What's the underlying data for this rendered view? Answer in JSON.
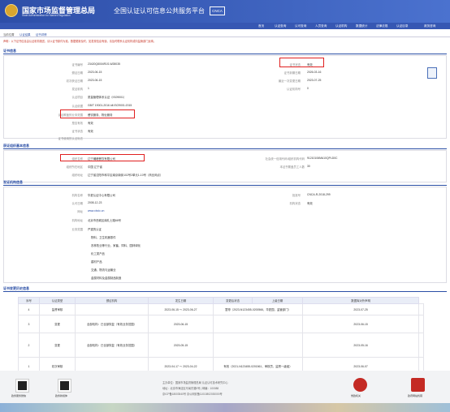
{
  "header": {
    "title": "国家市场监督管理总局",
    "title_en": "State Administration  for  Market Regulation",
    "subtitle": "全国认证认可信息公共服务平台",
    "logo_text": "CNCA"
  },
  "nav": [
    "首页",
    "认证查询",
    "认可查询",
    "人员查询",
    "认证机构",
    "数据统计",
    "法律法规",
    "认证目录",
    "政务咨询"
  ],
  "tabs": [
    "当前位置",
    "认证结果",
    "证书详情"
  ],
  "notice": "声明：以下证书信息由认证机构报送，请以证书原件为准。数据更新及时，如发现信息有误，请及时联系认证机构或向监管部门反映。",
  "sec1": {
    "title": "证书信息",
    "left": [
      [
        "证书编号",
        "23420Q8004R1S-W28035"
      ],
      [
        "颁证日期",
        "2023-06-15"
      ],
      [
        "初次获证日期",
        "2023-06-15"
      ],
      [
        "发证机构",
        "1"
      ],
      [
        "认证项目",
        "质量管理体系认证（ISO9001）"
      ],
      [
        "认证依据",
        "GB/T 19001-2016 idt ISO9001:2015"
      ],
      [
        "认证覆盖的业务范围",
        "餐饮服务、物业服务"
      ],
      [
        "是否有效",
        "有效"
      ],
      [
        "证书状态",
        "有效"
      ],
      [
        "证书使用的认证标志",
        ""
      ]
    ],
    "right": [
      [
        "证书状态",
        "有效"
      ],
      [
        "证书到期日期",
        "2026-03-16"
      ],
      [
        "最近一次变更日期",
        "2023-07-25"
      ],
      [
        "认证机构号",
        "0"
      ]
    ]
  },
  "sec2": {
    "title": "获证组织基本信息",
    "left": [
      [
        "组织名称",
        "辽宁瀚峰餐饮有限公司"
      ],
      [
        "组织所在地区",
        "中国 辽宁省"
      ],
      [
        "组织地址",
        "辽宁省沈阳市和平区南京南街102号2单元1-10号（商业网点）"
      ]
    ],
    "right": [
      [
        "社会统一信用代码/组织机构代码",
        "91210106MA10QPLD0C"
      ],
      [
        "本证书覆盖员工人数",
        "30"
      ]
    ]
  },
  "sec3": {
    "title": "发证机构信息",
    "left": [
      [
        "机构名称",
        "华夏认证中心有限公司"
      ],
      [
        "认可日期",
        "2008-12-23"
      ],
      [
        "网址",
        "www.cbcic.cn"
      ],
      [
        "机构地址",
        "北京市西城区南礼士路66号"
      ],
      [
        "业务范围",
        "严重的认证"
      ]
    ],
    "right": [
      [
        "批准号",
        "CNCA-R-2018-299"
      ],
      [
        "机构状态",
        "有效"
      ]
    ],
    "scope": [
      "物料，卫生机器零件",
      "农林牧业等行业、家畜、饲料、园林绿化",
      "化工类产品",
      "建材产品",
      "交通、物流与运输业",
      "金属材料及金属制品制造"
    ]
  },
  "sec4": {
    "title": "证书变更历史信息",
    "columns": [
      "序号",
      "认证类型",
      "颁证机构",
      "发生日期",
      "变更后状态",
      "上级日期",
      "数据库对外声明"
    ],
    "rows": [
      [
        "4",
        "监督审核",
        "",
        "2023-06-15 ～ 2023-06-27",
        "",
        "暂停（2023-N123455-0200566，华夏园，监管部门）",
        "2023-07-25",
        ""
      ],
      [
        "3",
        "变更",
        "全部机构：已全部恢复（有效业务范围）",
        "2023-06-15",
        "",
        "",
        "2023-06-15",
        ""
      ],
      [
        "2",
        "变更",
        "全部机构：已全部恢复（有效业务范围）",
        "2023-05-15",
        "",
        "",
        "2023-05-16",
        ""
      ],
      [
        "1",
        "初次审核",
        "",
        "2023-04-17 ～ 2023-04-22",
        "",
        "有效（2021-N123455-0201561，审核员，监督一级组）",
        "2023-06-07",
        ""
      ]
    ]
  },
  "footer": {
    "line1": "主办单位：国家市场监督管理总局 认证认可技术研究中心",
    "line2": "地址：北京市海淀区马甸东路9号 | 邮编：100088",
    "line3": "京ICP备18003540号  京公网安备11010802030000号",
    "qr1": "政务服务微信",
    "qr2": "政务新媒体",
    "badge1": "党政机关",
    "badge2": "政府网站找错"
  },
  "colors": {
    "header": "#2d4ea8",
    "accent": "#2b4fa6",
    "alert": "#e02020"
  }
}
